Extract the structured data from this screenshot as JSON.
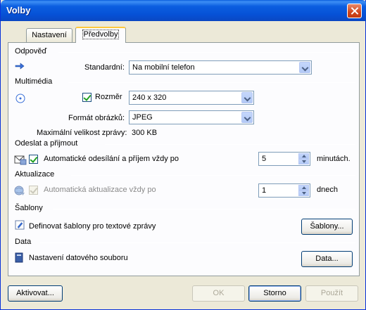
{
  "window": {
    "title": "Volby"
  },
  "tabs": [
    {
      "label": "Nastavení",
      "active": false
    },
    {
      "label": "Předvolby",
      "active": true
    }
  ],
  "sections": {
    "odpoved": {
      "heading": "Odpověď",
      "standard_label": "Standardní:",
      "standard_value": "Na mobilní telefon"
    },
    "multimedia": {
      "heading": "Multimédia",
      "size_label": "Rozměr",
      "size_checked": true,
      "size_value": "240 x 320",
      "format_label": "Formát obrázků:",
      "format_value": "JPEG",
      "max_size_label": "Maximální velikost zprávy:",
      "max_size_value": "300 KB"
    },
    "send_receive": {
      "heading": "Odeslat a přijmout",
      "auto_label": "Automatické odesílání a příjem vždy po",
      "auto_checked": true,
      "auto_value": "5",
      "auto_unit": "minutách."
    },
    "update": {
      "heading": "Aktualizace",
      "auto_label": "Automatická aktualizace vždy po",
      "auto_checked": true,
      "auto_enabled": false,
      "auto_value": "1",
      "auto_unit": "dnech"
    },
    "templates": {
      "heading": "Šablony",
      "description": "Definovat šablony pro textové zprávy",
      "button_label": "Šablony..."
    },
    "data": {
      "heading": "Data",
      "description": "Nastavení datového souboru",
      "button_label": "Data..."
    }
  },
  "footer": {
    "activate_label": "Aktivovat...",
    "ok_label": "OK",
    "ok_enabled": false,
    "cancel_label": "Storno",
    "apply_label": "Použít",
    "apply_enabled": false
  },
  "colors": {
    "titlebar": "#0b5ee0",
    "dialog_bg": "#ece9d8",
    "tab_highlight": "#ffc83c",
    "checkbox_tick": "#21a121"
  },
  "icons": {
    "reply": "arrow-right-icon",
    "multimedia": "disc-icon",
    "send_receive": "envelope-icon",
    "update": "update-globe-icon",
    "templates": "pencil-icon",
    "data": "data-book-icon"
  }
}
